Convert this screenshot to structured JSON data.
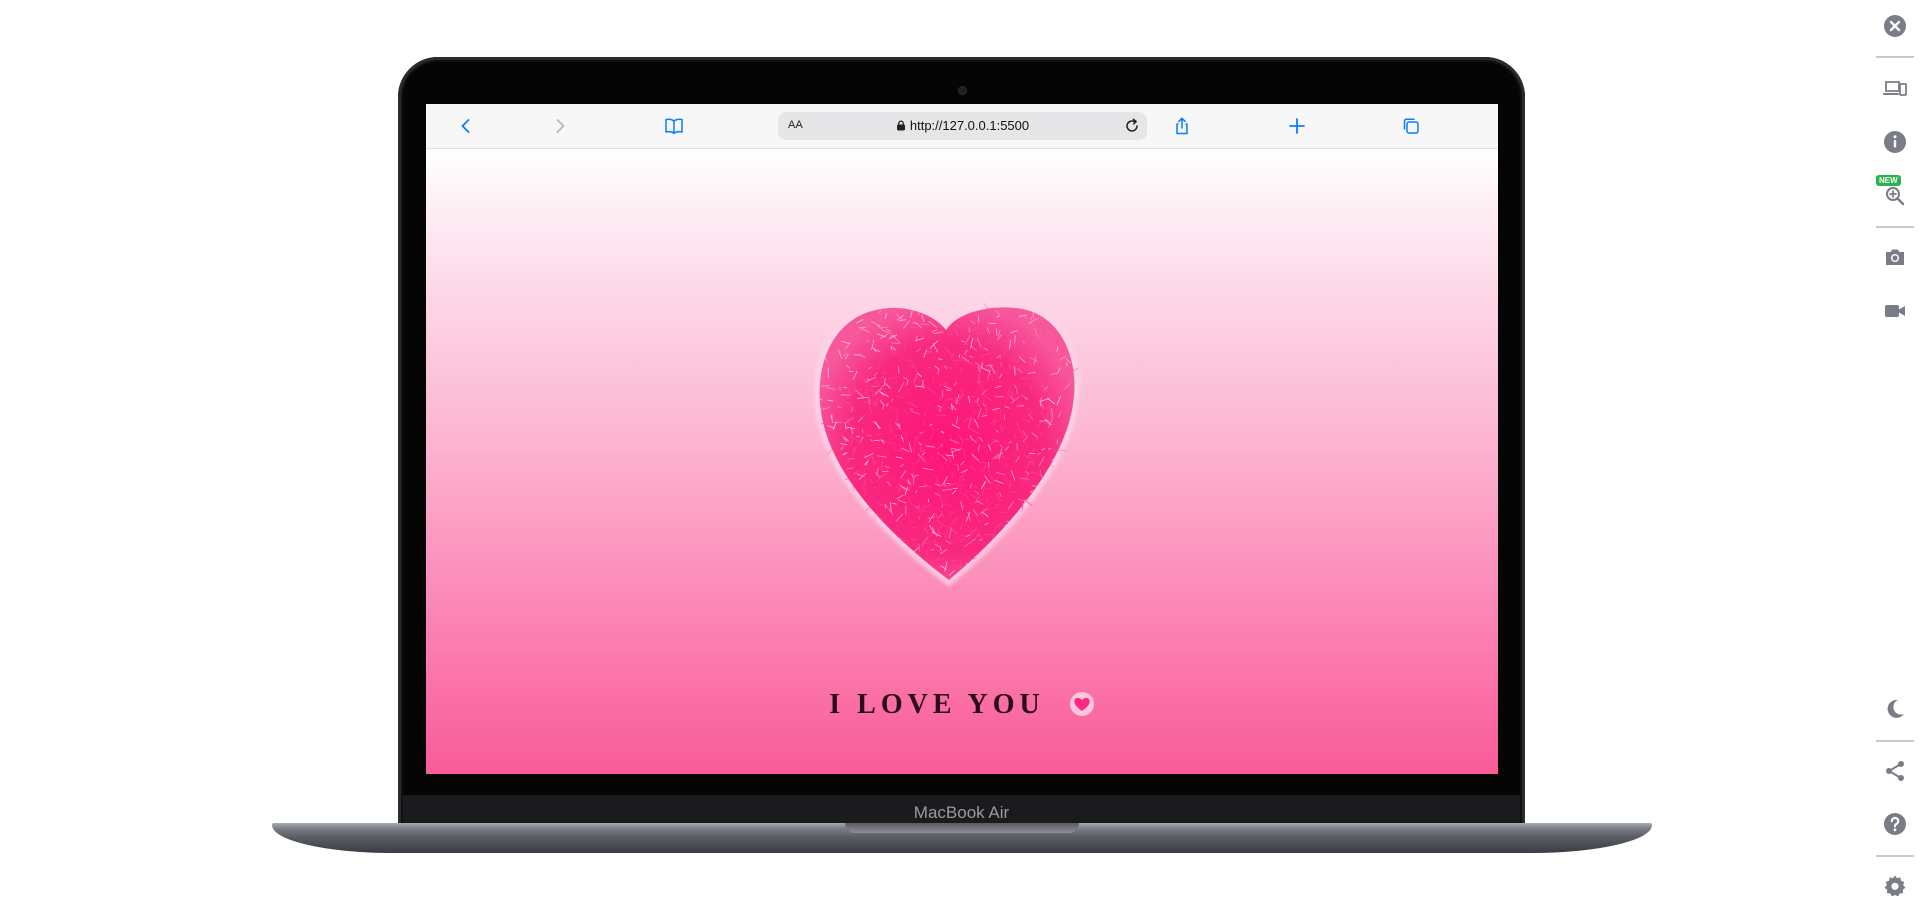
{
  "browser": {
    "url": "http://127.0.0.1:5500",
    "reader_label": "AA"
  },
  "page": {
    "message": "I LOVE YOU"
  },
  "device": {
    "model_label": "MacBook Air"
  },
  "side_rail": {
    "new_badge": "NEW"
  },
  "colors": {
    "accent": "#0a7cff",
    "heart": "#ff1a7a",
    "rail_icon": "#7a7d86"
  }
}
